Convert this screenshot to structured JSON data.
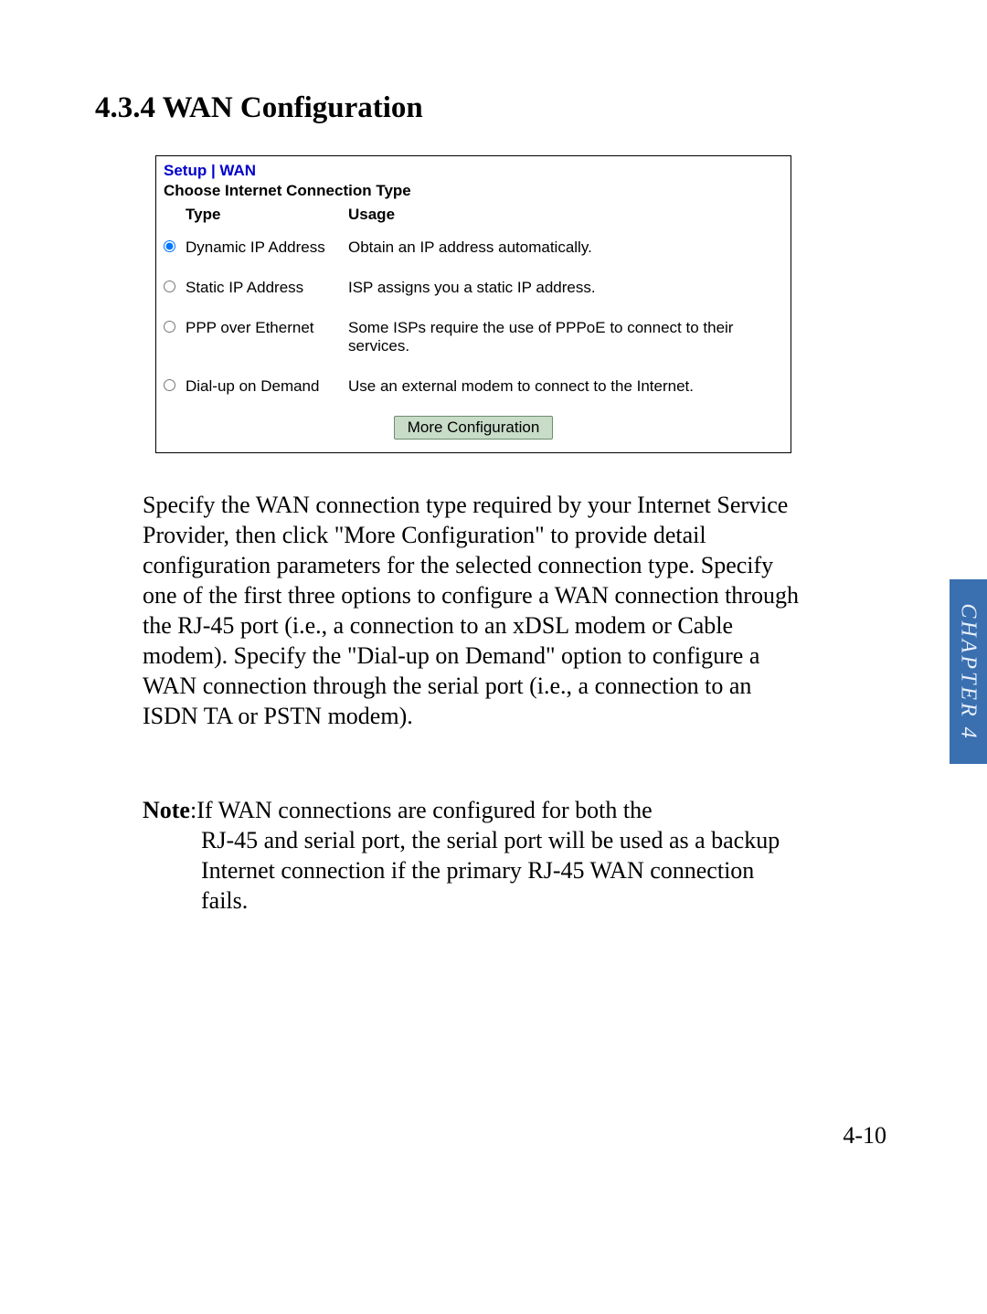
{
  "heading": "4.3.4 WAN Configuration",
  "panel": {
    "breadcrumb": "Setup | WAN",
    "subtitle": "Choose Internet Connection Type",
    "columns": {
      "type": "Type",
      "usage": "Usage"
    },
    "options": [
      {
        "selected": true,
        "type": "Dynamic IP Address",
        "usage": "Obtain an IP address automatically."
      },
      {
        "selected": false,
        "type": "Static IP Address",
        "usage": "ISP assigns you a static IP address."
      },
      {
        "selected": false,
        "type": "PPP over Ethernet",
        "usage": "Some ISPs require the use of PPPoE to connect to their services."
      },
      {
        "selected": false,
        "type": "Dial-up on Demand",
        "usage": "Use an external modem to connect to the Internet."
      }
    ],
    "button": "More Configuration"
  },
  "body_text": "Specify the WAN connection type required by your Internet Service Provider, then click \"More Configuration\" to provide detail configuration parameters for the selected connection type. Specify one of the first three options to configure a WAN connection through the RJ-45 port (i.e., a connection to an xDSL modem or Cable modem). Specify the \"Dial-up on Demand\" option to configure a WAN connection through the serial port (i.e., a connection to an ISDN TA or PSTN modem).",
  "note": {
    "label": "Note",
    "text": "If WAN connections are configured for both the RJ-45 and serial port, the serial port will be used as a backup Internet connection if the primary RJ-45 WAN connection fails."
  },
  "chapter_tab": "CHAPTER 4",
  "page_number": "4-10"
}
